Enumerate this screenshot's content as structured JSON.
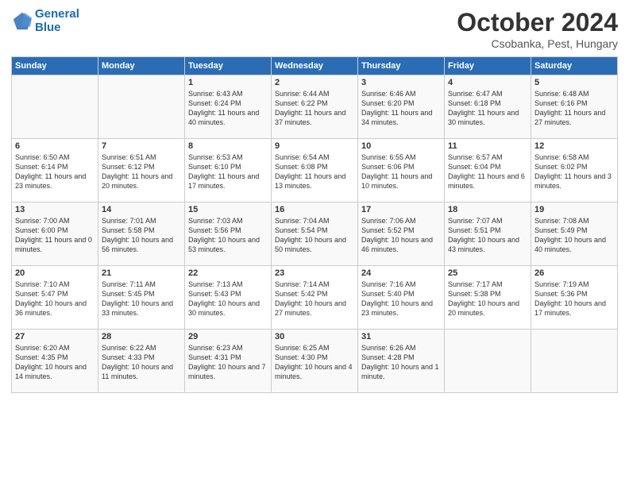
{
  "header": {
    "logo_line1": "General",
    "logo_line2": "Blue",
    "title": "October 2024",
    "subtitle": "Csobanka, Pest, Hungary"
  },
  "calendar": {
    "days_of_week": [
      "Sunday",
      "Monday",
      "Tuesday",
      "Wednesday",
      "Thursday",
      "Friday",
      "Saturday"
    ],
    "weeks": [
      [
        {
          "day": "",
          "content": ""
        },
        {
          "day": "",
          "content": ""
        },
        {
          "day": "1",
          "content": "Sunrise: 6:43 AM\nSunset: 6:24 PM\nDaylight: 11 hours\nand 40 minutes."
        },
        {
          "day": "2",
          "content": "Sunrise: 6:44 AM\nSunset: 6:22 PM\nDaylight: 11 hours\nand 37 minutes."
        },
        {
          "day": "3",
          "content": "Sunrise: 6:46 AM\nSunset: 6:20 PM\nDaylight: 11 hours\nand 34 minutes."
        },
        {
          "day": "4",
          "content": "Sunrise: 6:47 AM\nSunset: 6:18 PM\nDaylight: 11 hours\nand 30 minutes."
        },
        {
          "day": "5",
          "content": "Sunrise: 6:48 AM\nSunset: 6:16 PM\nDaylight: 11 hours\nand 27 minutes."
        }
      ],
      [
        {
          "day": "6",
          "content": "Sunrise: 6:50 AM\nSunset: 6:14 PM\nDaylight: 11 hours\nand 23 minutes."
        },
        {
          "day": "7",
          "content": "Sunrise: 6:51 AM\nSunset: 6:12 PM\nDaylight: 11 hours\nand 20 minutes."
        },
        {
          "day": "8",
          "content": "Sunrise: 6:53 AM\nSunset: 6:10 PM\nDaylight: 11 hours\nand 17 minutes."
        },
        {
          "day": "9",
          "content": "Sunrise: 6:54 AM\nSunset: 6:08 PM\nDaylight: 11 hours\nand 13 minutes."
        },
        {
          "day": "10",
          "content": "Sunrise: 6:55 AM\nSunset: 6:06 PM\nDaylight: 11 hours\nand 10 minutes."
        },
        {
          "day": "11",
          "content": "Sunrise: 6:57 AM\nSunset: 6:04 PM\nDaylight: 11 hours\nand 6 minutes."
        },
        {
          "day": "12",
          "content": "Sunrise: 6:58 AM\nSunset: 6:02 PM\nDaylight: 11 hours\nand 3 minutes."
        }
      ],
      [
        {
          "day": "13",
          "content": "Sunrise: 7:00 AM\nSunset: 6:00 PM\nDaylight: 11 hours\nand 0 minutes."
        },
        {
          "day": "14",
          "content": "Sunrise: 7:01 AM\nSunset: 5:58 PM\nDaylight: 10 hours\nand 56 minutes."
        },
        {
          "day": "15",
          "content": "Sunrise: 7:03 AM\nSunset: 5:56 PM\nDaylight: 10 hours\nand 53 minutes."
        },
        {
          "day": "16",
          "content": "Sunrise: 7:04 AM\nSunset: 5:54 PM\nDaylight: 10 hours\nand 50 minutes."
        },
        {
          "day": "17",
          "content": "Sunrise: 7:06 AM\nSunset: 5:52 PM\nDaylight: 10 hours\nand 46 minutes."
        },
        {
          "day": "18",
          "content": "Sunrise: 7:07 AM\nSunset: 5:51 PM\nDaylight: 10 hours\nand 43 minutes."
        },
        {
          "day": "19",
          "content": "Sunrise: 7:08 AM\nSunset: 5:49 PM\nDaylight: 10 hours\nand 40 minutes."
        }
      ],
      [
        {
          "day": "20",
          "content": "Sunrise: 7:10 AM\nSunset: 5:47 PM\nDaylight: 10 hours\nand 36 minutes."
        },
        {
          "day": "21",
          "content": "Sunrise: 7:11 AM\nSunset: 5:45 PM\nDaylight: 10 hours\nand 33 minutes."
        },
        {
          "day": "22",
          "content": "Sunrise: 7:13 AM\nSunset: 5:43 PM\nDaylight: 10 hours\nand 30 minutes."
        },
        {
          "day": "23",
          "content": "Sunrise: 7:14 AM\nSunset: 5:42 PM\nDaylight: 10 hours\nand 27 minutes."
        },
        {
          "day": "24",
          "content": "Sunrise: 7:16 AM\nSunset: 5:40 PM\nDaylight: 10 hours\nand 23 minutes."
        },
        {
          "day": "25",
          "content": "Sunrise: 7:17 AM\nSunset: 5:38 PM\nDaylight: 10 hours\nand 20 minutes."
        },
        {
          "day": "26",
          "content": "Sunrise: 7:19 AM\nSunset: 5:36 PM\nDaylight: 10 hours\nand 17 minutes."
        }
      ],
      [
        {
          "day": "27",
          "content": "Sunrise: 6:20 AM\nSunset: 4:35 PM\nDaylight: 10 hours\nand 14 minutes."
        },
        {
          "day": "28",
          "content": "Sunrise: 6:22 AM\nSunset: 4:33 PM\nDaylight: 10 hours\nand 11 minutes."
        },
        {
          "day": "29",
          "content": "Sunrise: 6:23 AM\nSunset: 4:31 PM\nDaylight: 10 hours\nand 7 minutes."
        },
        {
          "day": "30",
          "content": "Sunrise: 6:25 AM\nSunset: 4:30 PM\nDaylight: 10 hours\nand 4 minutes."
        },
        {
          "day": "31",
          "content": "Sunrise: 6:26 AM\nSunset: 4:28 PM\nDaylight: 10 hours\nand 1 minute."
        },
        {
          "day": "",
          "content": ""
        },
        {
          "day": "",
          "content": ""
        }
      ]
    ]
  }
}
